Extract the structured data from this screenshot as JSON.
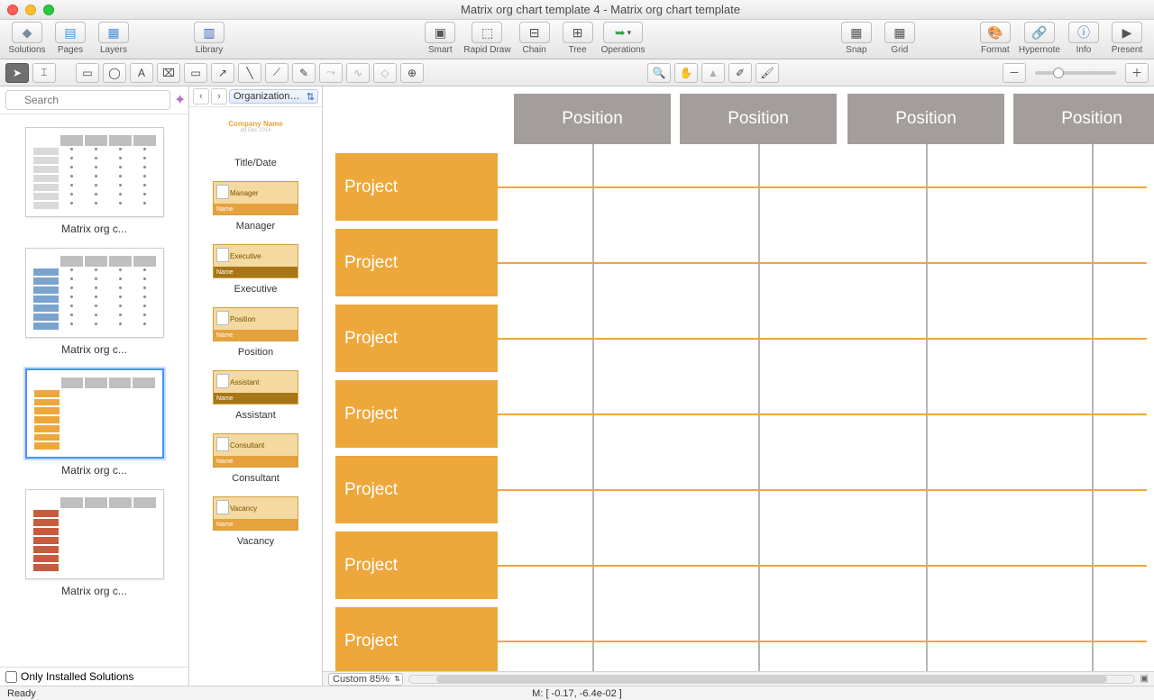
{
  "window": {
    "title": "Matrix org chart template 4 - Matrix org chart template"
  },
  "toolbar": {
    "solutions": "Solutions",
    "pages": "Pages",
    "layers": "Layers",
    "library": "Library",
    "smart": "Smart",
    "rapid": "Rapid Draw",
    "chain": "Chain",
    "tree": "Tree",
    "operations": "Operations",
    "snap": "Snap",
    "grid": "Grid",
    "format": "Format",
    "hypernote": "Hypernote",
    "info": "Info",
    "present": "Present"
  },
  "left": {
    "search_placeholder": "Search",
    "thumbs": [
      {
        "label": "Matrix org c...",
        "variant": "gray"
      },
      {
        "label": "Matrix org c...",
        "variant": "blue"
      },
      {
        "label": "Matrix org c...",
        "variant": "orange",
        "selected": true
      },
      {
        "label": "Matrix org c...",
        "variant": "red"
      }
    ],
    "only_installed": "Only Installed Solutions"
  },
  "library": {
    "select_label": "Organizationa...",
    "items": [
      {
        "label": "Title/Date",
        "tag": "Company Name"
      },
      {
        "label": "Manager",
        "tag": "Manager"
      },
      {
        "label": "Executive",
        "tag": "Executive"
      },
      {
        "label": "Position",
        "tag": "Position"
      },
      {
        "label": "Assistant",
        "tag": "Assistant"
      },
      {
        "label": "Consultant",
        "tag": "Consultant"
      },
      {
        "label": "Vacancy",
        "tag": "Vacancy"
      }
    ],
    "name_field": "Name"
  },
  "canvas": {
    "positions": [
      "Position",
      "Position",
      "Position",
      "Position"
    ],
    "projects": [
      "Project",
      "Project",
      "Project",
      "Project",
      "Project",
      "Project",
      "Project"
    ],
    "zoom_label": "Custom 85%"
  },
  "status": {
    "ready": "Ready",
    "coords": "M: [ -0.17, -6.4e-02 ]"
  }
}
